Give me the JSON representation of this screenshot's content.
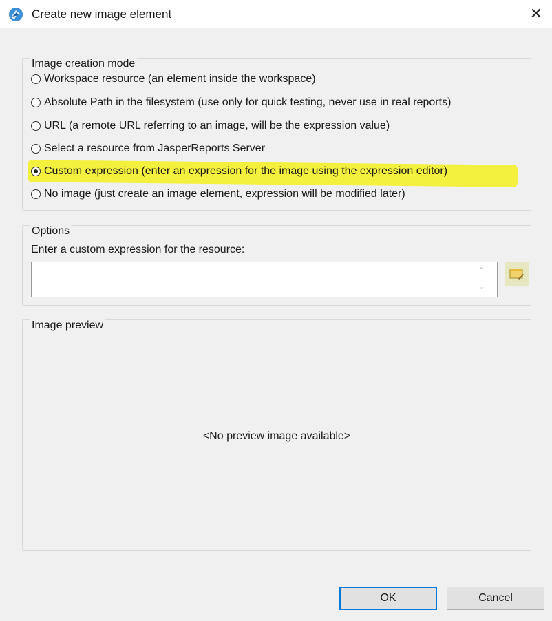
{
  "window": {
    "title": "Create new image element",
    "close_glyph": "✕",
    "app_icon": "jaspersoft-logo-icon"
  },
  "image_creation_mode": {
    "legend": "Image creation mode",
    "options": [
      {
        "label": "Workspace resource (an element inside the workspace)",
        "selected": false
      },
      {
        "label": "Absolute Path in the filesystem (use only for quick testing, never use in real reports)",
        "selected": false
      },
      {
        "label": "URL (a remote URL referring to an image, will be the expression value)",
        "selected": false
      },
      {
        "label": "Select a resource from JasperReports Server",
        "selected": false
      },
      {
        "label": "Custom expression (enter an expression for the image using the expression editor)",
        "selected": true
      },
      {
        "label": "No image (just create an image element, expression will be modified later)",
        "selected": false
      }
    ],
    "highlight_color": "#f4f01e"
  },
  "options": {
    "legend": "Options",
    "expression_label": "Enter a custom expression for the resource:",
    "expression_value": "",
    "expression_editor_icon": "expression-editor-icon"
  },
  "image_preview": {
    "legend": "Image preview",
    "empty_text": "<No preview image available>"
  },
  "buttons": {
    "ok": "OK",
    "cancel": "Cancel"
  },
  "colors": {
    "dialog_background": "#f0f0f0",
    "default_button_border": "#0078d7"
  }
}
